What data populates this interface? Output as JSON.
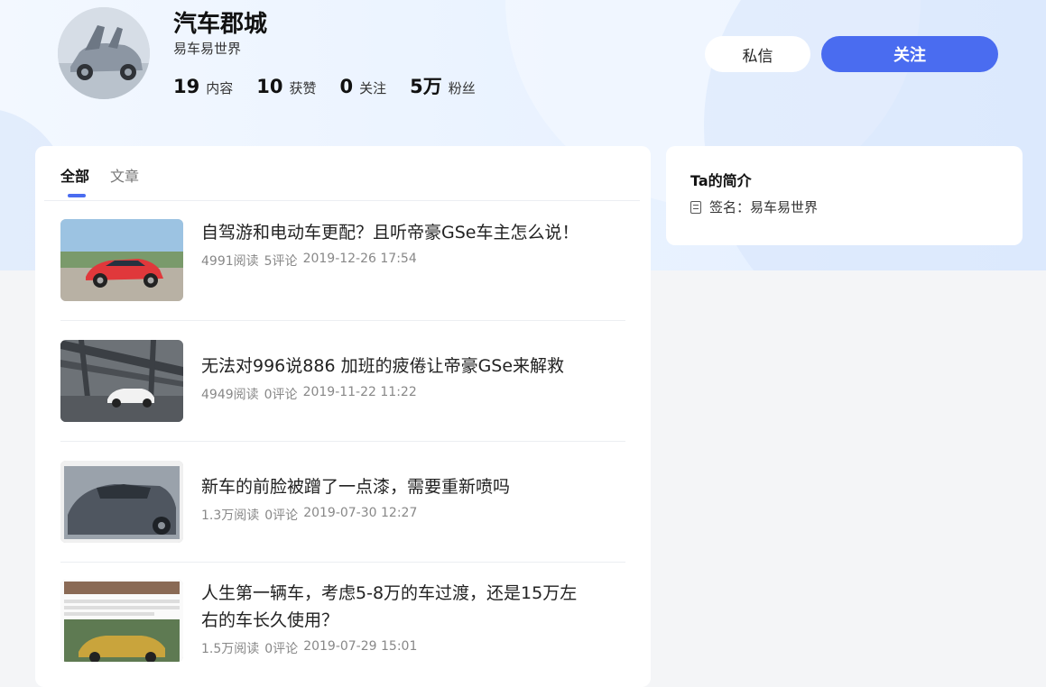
{
  "profile": {
    "name": "汽车郡城",
    "signature": "易车易世界",
    "stats": [
      {
        "num": "19",
        "label": "内容"
      },
      {
        "num": "10",
        "label": "获赞"
      },
      {
        "num": "0",
        "label": "关注"
      },
      {
        "num": "5万",
        "label": "粉丝"
      }
    ],
    "message_label": "私信",
    "follow_label": "关注"
  },
  "tabs": [
    {
      "label": "全部",
      "active": true
    },
    {
      "label": "文章",
      "active": false
    }
  ],
  "articles": [
    {
      "title": "自驾游和电动车更配？且听帝豪GSe车主怎么说！",
      "reads": "4991阅读",
      "comments": "5评论",
      "date": "2019-12-26 17:54"
    },
    {
      "title": "无法对996说886 加班的疲倦让帝豪GSe来解救",
      "reads": "4949阅读",
      "comments": "0评论",
      "date": "2019-11-22 11:22"
    },
    {
      "title": "新车的前脸被蹭了一点漆，需要重新喷吗",
      "reads": "1.3万阅读",
      "comments": "0评论",
      "date": "2019-07-30 12:27"
    },
    {
      "title": "人生第一辆车，考虑5-8万的车过渡，还是15万左右的车长久使用？",
      "reads": "1.5万阅读",
      "comments": "0评论",
      "date": "2019-07-29 15:01"
    }
  ],
  "sidebar": {
    "title": "Ta的简介",
    "signature": "签名：易车易世界"
  },
  "colors": {
    "accent": "#4a6cf0",
    "hero_bg": "#e9f2ff",
    "page_bg": "#f4f5f7"
  }
}
